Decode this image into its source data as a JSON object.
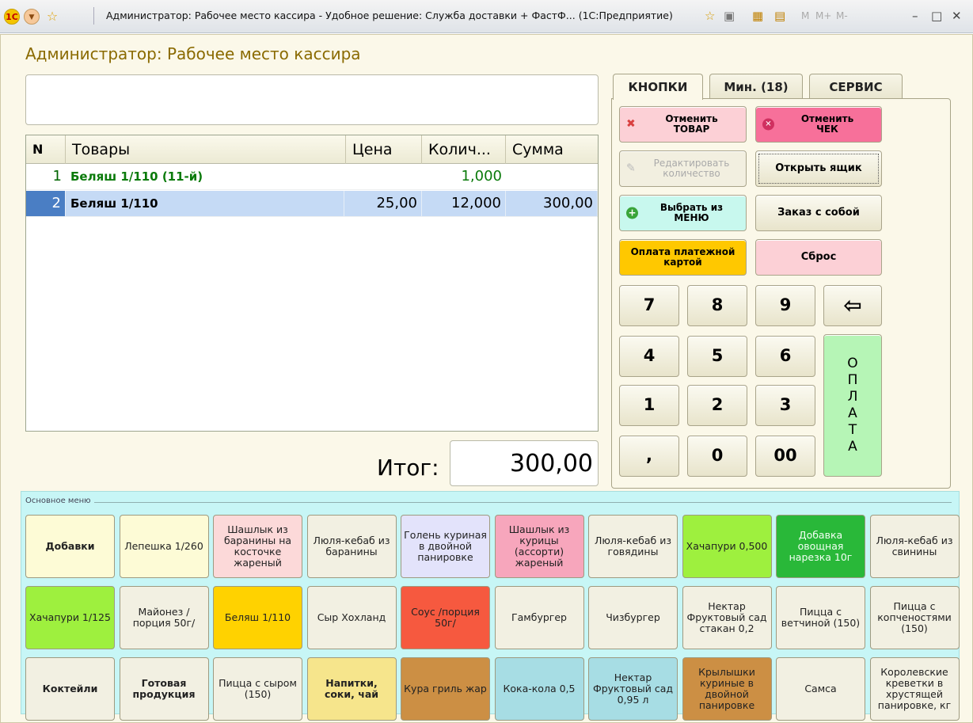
{
  "window": {
    "title": "Администратор: Рабочее место кассира - Удобное решение: Служба доставки + ФастФ...  (1С:Предприятие)",
    "controls": {
      "m": "M",
      "mplus": "M+",
      "mminus": "M-",
      "minimize": "–",
      "maximize": "□",
      "close": "✕"
    }
  },
  "form": {
    "title": "Администратор: Рабочее место кассира"
  },
  "grid": {
    "columns": [
      "N",
      "Товары",
      "Цена",
      "Колич...",
      "Сумма"
    ],
    "rows": [
      {
        "n": "1",
        "item": "Беляш 1/110 (11-й)",
        "price": "",
        "qty": "1,000",
        "sum": ""
      },
      {
        "n": "2",
        "item": "Беляш 1/110",
        "price": "25,00",
        "qty": "12,000",
        "sum": "300,00"
      }
    ]
  },
  "total": {
    "label": "Итог:",
    "value": "300,00"
  },
  "tabs": [
    "КНОПКИ",
    "Мин. (18)",
    "СЕРВИС"
  ],
  "buttons": {
    "cancel_item": "Отменить ТОВАР",
    "cancel_check": "Отменить ЧЕК",
    "edit_qty": "Редактировать количество",
    "open_drawer": "Открыть ящик",
    "choose_menu": "Выбрать из МЕНЮ",
    "takeaway": "Заказ с собой",
    "card_payment": "Оплата платежной картой",
    "reset": "Сброс",
    "pay": "О П Л А Т А"
  },
  "keypad": [
    "7",
    "8",
    "9",
    "4",
    "5",
    "6",
    "1",
    "2",
    "3",
    ",",
    "0",
    "00"
  ],
  "menu": {
    "caption": "Основное меню",
    "items": [
      {
        "label": "Добавки",
        "color": "#fdfbd6"
      },
      {
        "label": "Лепешка 1/260",
        "color": "#fdfbd6"
      },
      {
        "label": "Шашлык из баранины на косточке жареный",
        "color": "#fcd9d9"
      },
      {
        "label": "Люля-кебаб из баранины",
        "color": "#f2f0e2"
      },
      {
        "label": "Голень куриная в двойной панировке",
        "color": "#e3e3fb"
      },
      {
        "label": "Шашлык из курицы (ассорти) жареный",
        "color": "#f7a6bc"
      },
      {
        "label": "Люля-кебаб из говядины",
        "color": "#f2f0e2"
      },
      {
        "label": "Хачапури 0,500",
        "color": "#9ef03e"
      },
      {
        "label": "Добавка овощная нарезка 10г",
        "color": "#29b839"
      },
      {
        "label": "Люля-кебаб из свинины",
        "color": "#f2f0e2"
      },
      {
        "label": "Хачапури 1/125",
        "color": "#9ef03e"
      },
      {
        "label": "Майонез /порция 50г/",
        "color": "#f2f0e2"
      },
      {
        "label": "Беляш 1/110",
        "color": "#ffd200"
      },
      {
        "label": "Сыр Хохланд",
        "color": "#f2f0e2"
      },
      {
        "label": "Соус /порция 50г/",
        "color": "#f6593f"
      },
      {
        "label": "Гамбургер",
        "color": "#f2f0e2"
      },
      {
        "label": "Чизбургер",
        "color": "#f2f0e2"
      },
      {
        "label": "Нектар Фруктовый сад стакан 0,2",
        "color": "#f2f0e2"
      },
      {
        "label": "Пицца с ветчиной (150)",
        "color": "#f2f0e2"
      },
      {
        "label": "Пицца с копченостями (150)",
        "color": "#f2f0e2"
      },
      {
        "label": "Коктейли",
        "color": "#f2f0e2"
      },
      {
        "label": "Готовая продукция",
        "color": "#f2f0e2"
      },
      {
        "label": "Пицца с сыром (150)",
        "color": "#f2f0e2"
      },
      {
        "label": "Напитки, соки, чай",
        "color": "#f6e58c"
      },
      {
        "label": "Кура гриль жар",
        "color": "#cc8f44"
      },
      {
        "label": "Кока-кола 0,5",
        "color": "#a7dde4"
      },
      {
        "label": "Нектар Фруктовый сад 0,95 л",
        "color": "#a7dde4"
      },
      {
        "label": "Крылышки куриные в двойной панировке",
        "color": "#cc8f44"
      },
      {
        "label": "Самса",
        "color": "#f2f0e2"
      },
      {
        "label": "Королевские креветки в хрустящей панировке, кг",
        "color": "#f2f0e2"
      }
    ]
  }
}
